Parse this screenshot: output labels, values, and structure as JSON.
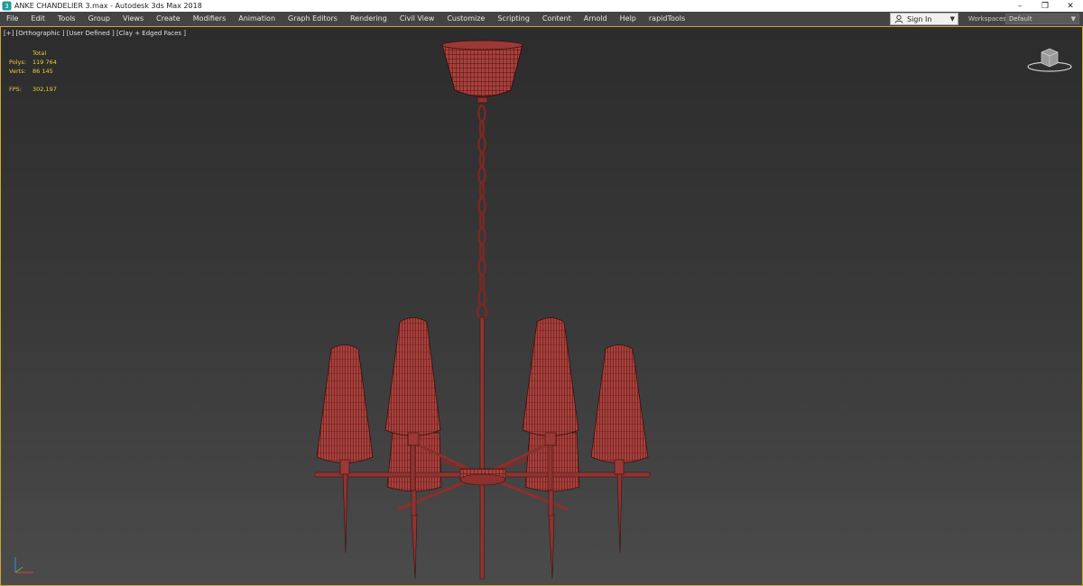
{
  "window": {
    "title": "ANKE CHANDELIER 3.max - Autodesk 3ds Max 2018",
    "controls": {
      "minimize": "–",
      "restore": "❐",
      "close": "✕"
    }
  },
  "menu": {
    "items": [
      "File",
      "Edit",
      "Tools",
      "Group",
      "Views",
      "Create",
      "Modifiers",
      "Animation",
      "Graph Editors",
      "Rendering",
      "Civil View",
      "Customize",
      "Scripting",
      "Content",
      "Arnold",
      "Help",
      "rapidTools"
    ],
    "sign_in": "Sign In",
    "workspaces_label": "Workspaces:",
    "workspace_value": "Default"
  },
  "viewport": {
    "label": "[+] [Orthographic ] [User Defined ] [Clay + Edged Faces ]",
    "stats": {
      "header": "Total",
      "polys_label": "Polys:",
      "polys_value": "119 764",
      "verts_label": "Verts:",
      "verts_value": "86 145",
      "fps_label": "FPS:",
      "fps_value": "302,197"
    }
  },
  "colors": {
    "accent_border": "#c9a63a",
    "stats_text": "#e8d23a",
    "model_fill": "#a8403c",
    "model_wire": "#4a1412"
  },
  "icons": {
    "app": "3ds-max-logo-icon",
    "user": "user-icon",
    "viewcube": "viewcube-icon",
    "axis": "axis-tripod-icon"
  }
}
